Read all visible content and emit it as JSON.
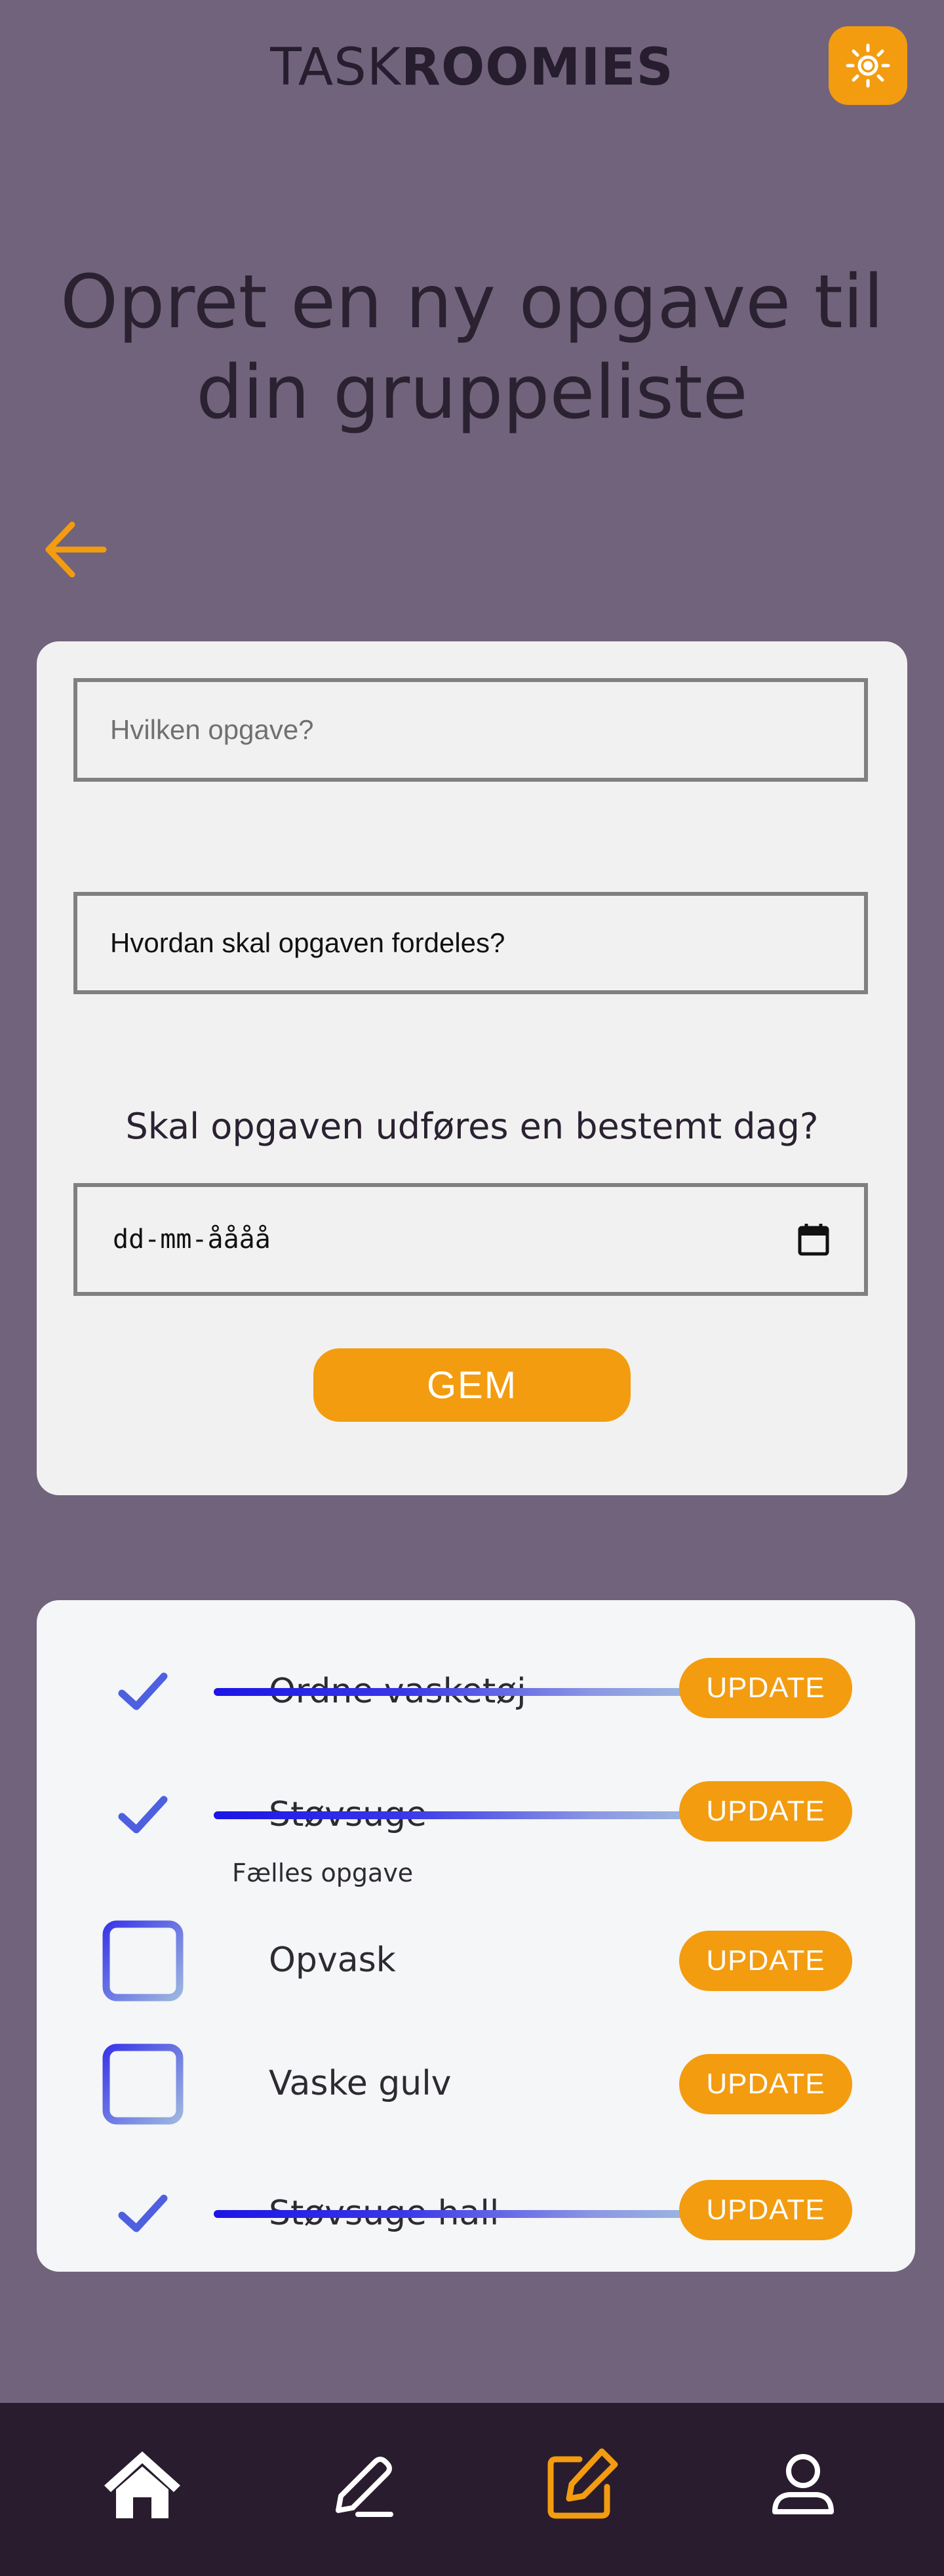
{
  "app": {
    "logo_light": "TASK",
    "logo_bold": "ROOMIES",
    "theme_toggle_icon": "sun-icon"
  },
  "page": {
    "title": "Opret en ny opgave til din gruppeliste",
    "back_icon": "arrow-left-icon"
  },
  "form": {
    "task_placeholder": "Hvilken opgave?",
    "distribution_value": "Hvordan skal opgaven fordeles?",
    "date_question": "Skal opgaven udføres en bestemt dag?",
    "date_placeholder": "dd-mm-åååå",
    "save_label": "GEM"
  },
  "tasks": [
    {
      "label": "Ordne vasketøj",
      "done": true,
      "update_label": "UPDATE"
    },
    {
      "label": "Støvsuge",
      "done": true,
      "update_label": "UPDATE"
    },
    {
      "label": "Opvask",
      "done": false,
      "update_label": "UPDATE"
    },
    {
      "label": "Vaske gulv",
      "done": false,
      "update_label": "UPDATE"
    },
    {
      "label": "Støvsuge hall",
      "done": true,
      "update_label": "UPDATE"
    }
  ],
  "group_note": "Fælles opgave",
  "nav": {
    "items": [
      "home-icon",
      "pencil-icon",
      "edit-square-icon",
      "user-icon"
    ]
  },
  "colors": {
    "background": "#71637c",
    "accent": "#f39c0f",
    "nav_background": "#291c2e",
    "check": "#4e5fe0"
  }
}
